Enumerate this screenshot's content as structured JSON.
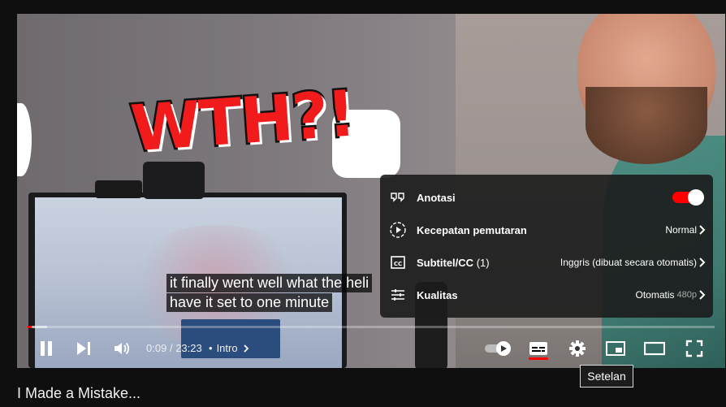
{
  "video": {
    "title": "I Made a Mistake...",
    "overlay_text": "WTH?!",
    "subtitles": [
      "it finally went well what the heli",
      "have it set to one minute"
    ],
    "progress_fraction": 0.0064
  },
  "settings_menu": {
    "items": [
      {
        "icon": "annotation-icon",
        "label": "Anotasi",
        "toggle_on": true
      },
      {
        "icon": "playback-speed-icon",
        "label": "Kecepatan pemutaran",
        "value": "Normal"
      },
      {
        "icon": "subtitles-cc-icon",
        "label": "Subtitel/CC",
        "count": "(1)",
        "value": "Inggris (dibuat secara otomatis)"
      },
      {
        "icon": "quality-sliders-icon",
        "label": "Kualitas",
        "value": "Otomatis",
        "value_sub": "480p"
      }
    ]
  },
  "controls": {
    "time_current": "0:09",
    "time_separator": "/",
    "time_total": "23:23",
    "chapter_bullet": "•",
    "chapter": "Intro",
    "tooltip": "Setelan"
  },
  "colors": {
    "accent": "#ff0000",
    "menu_bg": "#1c1c1c",
    "page_bg": "#0f0f0f"
  }
}
